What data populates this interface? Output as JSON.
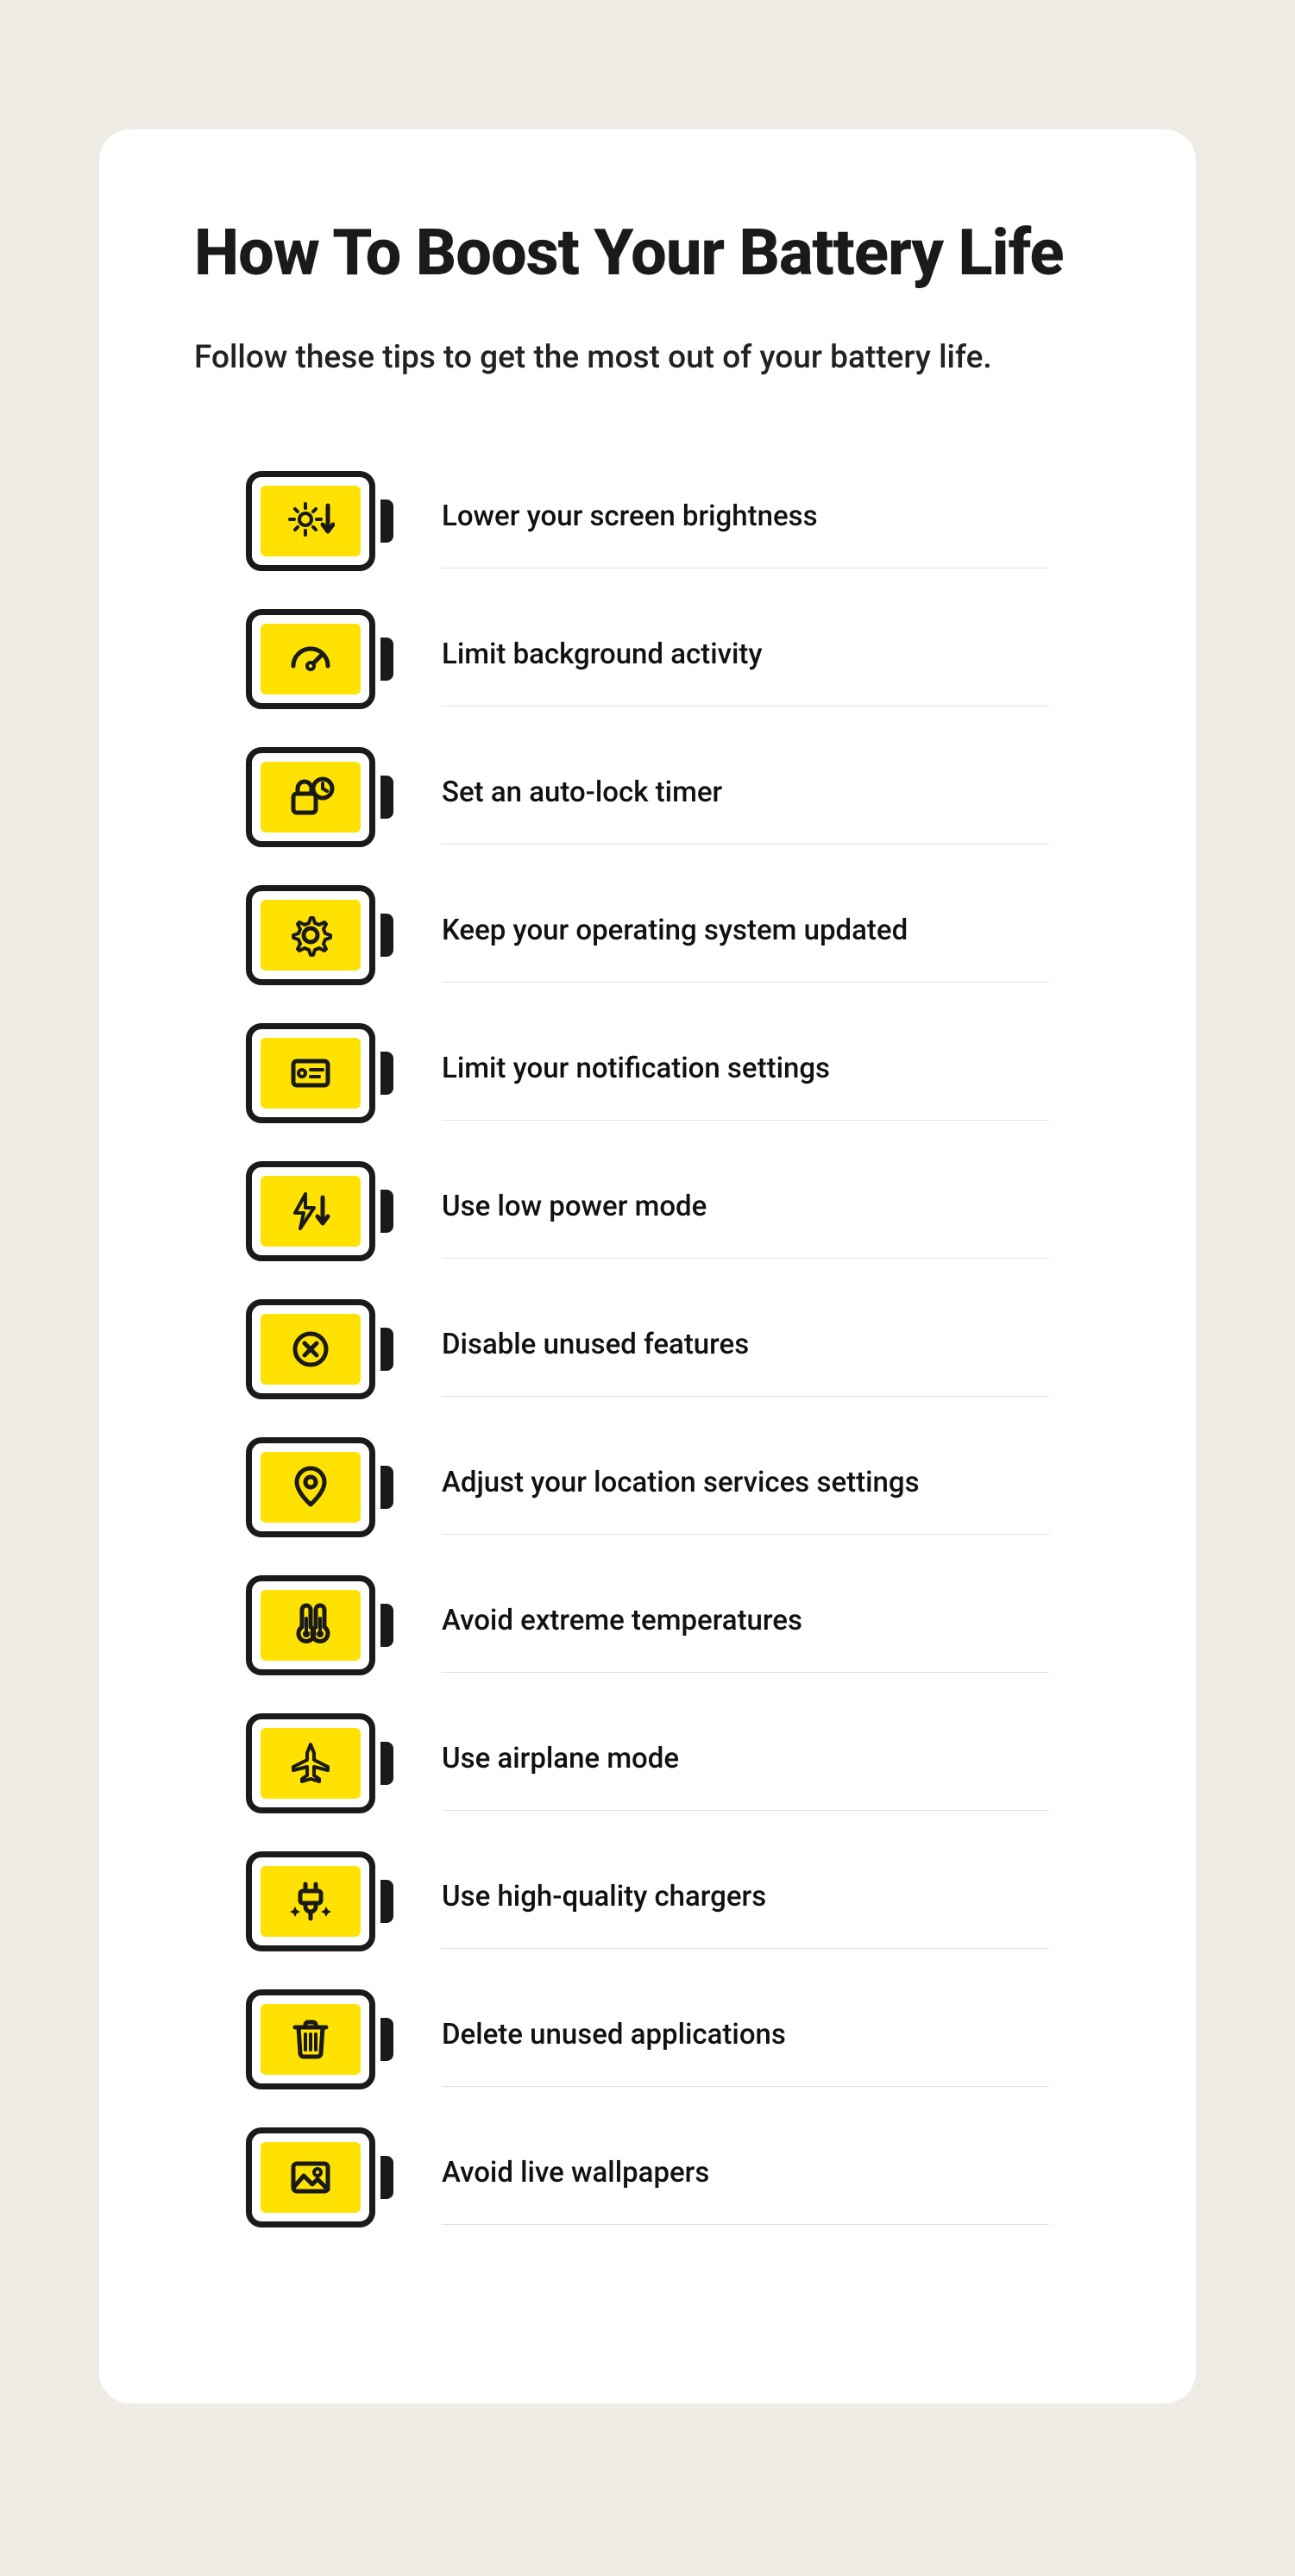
{
  "title": "How To Boost Your Battery Life",
  "subtitle": "Follow these tips to get the most out of your battery life.",
  "colors": {
    "accent": "#ffe201",
    "icon_stroke": "#1a1a1a",
    "page_bg": "#efece6",
    "card_bg": "#ffffff",
    "divider": "#d8e1ef"
  },
  "tips": [
    {
      "icon": "brightness-down-icon",
      "label": "Lower your screen brightness"
    },
    {
      "icon": "gauge-icon",
      "label": "Limit background activity"
    },
    {
      "icon": "lock-timer-icon",
      "label": "Set an auto-lock timer"
    },
    {
      "icon": "gear-icon",
      "label": "Keep your operating system updated"
    },
    {
      "icon": "notification-card-icon",
      "label": "Limit your notification settings"
    },
    {
      "icon": "low-power-icon",
      "label": "Use low power mode"
    },
    {
      "icon": "x-circle-icon",
      "label": "Disable unused features"
    },
    {
      "icon": "location-pin-icon",
      "label": "Adjust your location services settings"
    },
    {
      "icon": "thermometer-icon",
      "label": "Avoid extreme temperatures"
    },
    {
      "icon": "airplane-icon",
      "label": "Use airplane mode"
    },
    {
      "icon": "charger-plug-icon",
      "label": "Use high-quality chargers"
    },
    {
      "icon": "trash-icon",
      "label": "Delete unused applications"
    },
    {
      "icon": "image-icon",
      "label": "Avoid live wallpapers"
    }
  ]
}
